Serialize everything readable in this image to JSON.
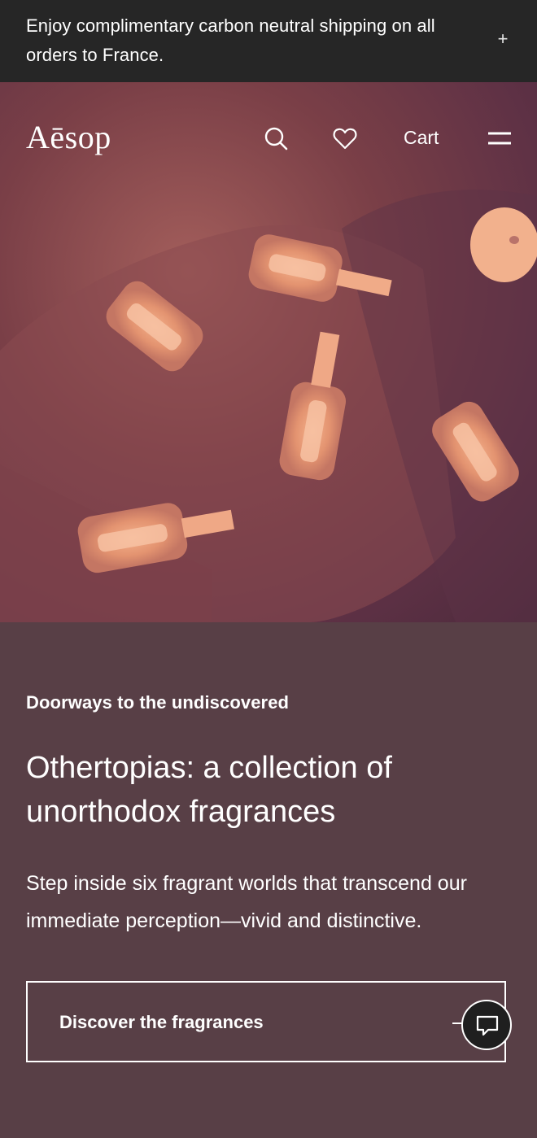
{
  "banner": {
    "text": "Enjoy complimentary carbon neutral shipping on all orders to France.",
    "toggle_icon": "plus-icon",
    "toggle_glyph": "+"
  },
  "header": {
    "logo": "Aēsop",
    "icons": [
      "search-icon",
      "heart-icon",
      "menu-icon"
    ],
    "cart_label": "Cart"
  },
  "hero": {
    "image_subject": "amber fragrance vials on a mauve surface"
  },
  "content": {
    "eyebrow": "Doorways to the undiscovered",
    "headline": "Othertopias: a collection of unorthodox fragrances",
    "description": "Step inside six fragrant worlds that transcend our immediate perception—vivid and distinctive.",
    "cta_label": "Discover the fragrances"
  },
  "chat": {
    "icon": "chat-icon"
  },
  "colors": {
    "banner_bg": "#262626",
    "content_bg": "#583f46",
    "text": "#ffffff"
  }
}
